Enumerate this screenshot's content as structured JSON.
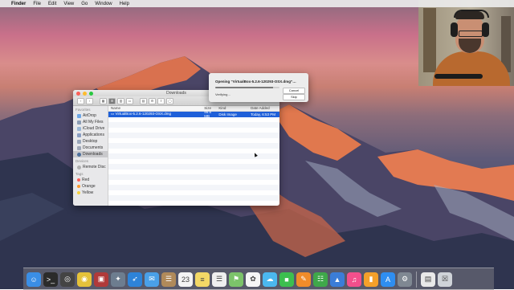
{
  "menubar": {
    "app_name": "Finder",
    "items": [
      "File",
      "Edit",
      "View",
      "Go",
      "Window",
      "Help"
    ]
  },
  "finder": {
    "title": "Downloads",
    "sidebar": {
      "favorites_label": "Favorites",
      "favorites": [
        {
          "label": "AirDrop",
          "icon": "airdrop-icon",
          "color": "#6ea7e6"
        },
        {
          "label": "All My Files",
          "icon": "all-files-icon",
          "color": "#8c9db5"
        },
        {
          "label": "iCloud Drive",
          "icon": "cloud-icon",
          "color": "#9bb8d6"
        },
        {
          "label": "Applications",
          "icon": "applications-icon",
          "color": "#8a9ec3"
        },
        {
          "label": "Desktop",
          "icon": "desktop-icon",
          "color": "#9aa7ba"
        },
        {
          "label": "Documents",
          "icon": "documents-icon",
          "color": "#a0a8b8"
        },
        {
          "label": "Downloads",
          "icon": "downloads-icon",
          "color": "#4d6f9c",
          "active": true
        }
      ],
      "devices_label": "Devices",
      "devices": [
        {
          "label": "Remote Disc",
          "icon": "disc-icon",
          "color": "#b0b0b0"
        }
      ],
      "tags_label": "Tags",
      "tags": [
        {
          "label": "Red",
          "color": "#fc5f57"
        },
        {
          "label": "Orange",
          "color": "#fd9a2e"
        },
        {
          "label": "Yellow",
          "color": "#f7d23d"
        }
      ]
    },
    "columns": [
      "Name",
      "Size",
      "Kind",
      "Date Added"
    ],
    "rows": [
      {
        "name": "VirtualBox-5.2.6-120293-OSX.dmg",
        "size": "95.8 MB",
        "kind": "Disk Image",
        "date": "Today, 6:53 PM"
      }
    ]
  },
  "dialog": {
    "title": "Opening “VirtualBox-5.2.6-120293-OSX.dmg”…",
    "status": "Verifying…",
    "progress": 0.9,
    "cancel_label": "Cancel",
    "skip_label": "Skip"
  },
  "dock": {
    "icons": [
      {
        "name": "finder-icon",
        "color": "#3a8ee6",
        "glyph": "☺"
      },
      {
        "name": "terminal-icon",
        "color": "#2b2b2b",
        "glyph": ">_"
      },
      {
        "name": "obs-icon",
        "color": "#444",
        "glyph": "◎"
      },
      {
        "name": "chrome-icon",
        "color": "#e5c23a",
        "glyph": "◉"
      },
      {
        "name": "photo-booth-icon",
        "color": "#b03a3a",
        "glyph": "▣"
      },
      {
        "name": "launchpad-icon",
        "color": "#6d7d8f",
        "glyph": "✦"
      },
      {
        "name": "safari-icon",
        "color": "#2d83d8",
        "glyph": "➶"
      },
      {
        "name": "mail-icon",
        "color": "#4aa0e8",
        "glyph": "✉"
      },
      {
        "name": "contacts-icon",
        "color": "#b08a5a",
        "glyph": "☰"
      },
      {
        "name": "calendar-icon",
        "color": "#f4f4f4",
        "glyph": "23"
      },
      {
        "name": "notes-icon",
        "color": "#f3d866",
        "glyph": "≡"
      },
      {
        "name": "reminders-icon",
        "color": "#efefef",
        "glyph": "☰"
      },
      {
        "name": "maps-icon",
        "color": "#7cc36a",
        "glyph": "⚑"
      },
      {
        "name": "photos-icon",
        "color": "#f6f6f6",
        "glyph": "✿"
      },
      {
        "name": "messages-icon",
        "color": "#4bb8f0",
        "glyph": "☁"
      },
      {
        "name": "facetime-icon",
        "color": "#3cbf4f",
        "glyph": "■"
      },
      {
        "name": "pages-icon",
        "color": "#f08c2a",
        "glyph": "✎"
      },
      {
        "name": "numbers-icon",
        "color": "#3fa84a",
        "glyph": "☷"
      },
      {
        "name": "keynote-icon",
        "color": "#3b7dd8",
        "glyph": "▲"
      },
      {
        "name": "itunes-icon",
        "color": "#f24f8c",
        "glyph": "♫"
      },
      {
        "name": "ibooks-icon",
        "color": "#f5a02a",
        "glyph": "▮"
      },
      {
        "name": "app-store-icon",
        "color": "#2f8ef0",
        "glyph": "A"
      },
      {
        "name": "system-preferences-icon",
        "color": "#7f8892",
        "glyph": "⚙"
      },
      {
        "name": "document-icon",
        "color": "#e9e9e9",
        "glyph": "▤"
      },
      {
        "name": "trash-icon",
        "color": "#cfd3d8",
        "glyph": "☒"
      }
    ]
  }
}
